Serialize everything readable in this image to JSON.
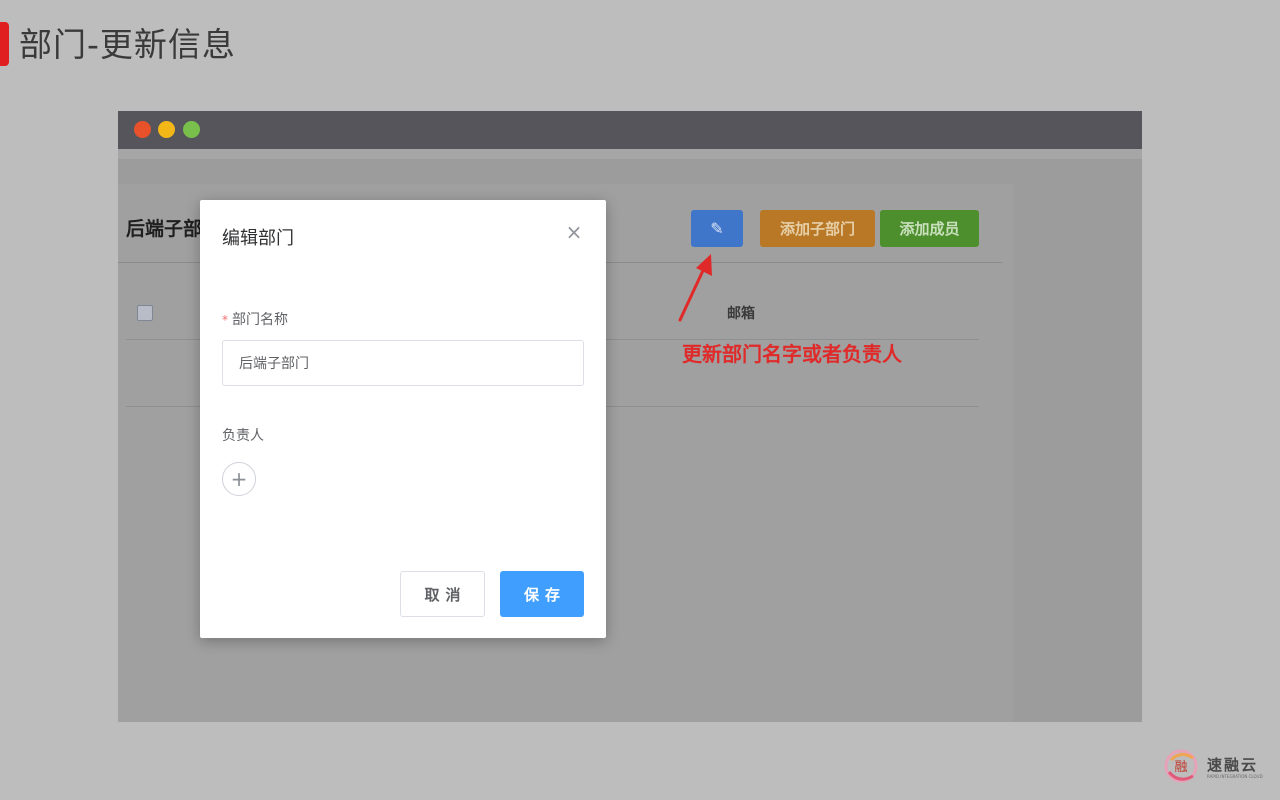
{
  "slide": {
    "title": "部门-更新信息",
    "accent_color": "#e02020"
  },
  "window": {
    "traffic_lights": [
      "#e8512a",
      "#f3b718",
      "#78c04b"
    ]
  },
  "page": {
    "dept_title": "后端子部",
    "edit_icon": "✎",
    "add_sub_dept_label": "添加子部门",
    "add_member_label": "添加成员",
    "table_header_email": "邮箱"
  },
  "annotation": {
    "text": "更新部门名字或者负责人",
    "color": "#e02a2a"
  },
  "modal": {
    "title": "编辑部门",
    "close_glyph": "×",
    "name_label": "部门名称",
    "required_mark": "*",
    "name_value": "后端子部门",
    "owner_label": "负责人",
    "add_owner_glyph": "+",
    "cancel_label": "取消",
    "save_label": "保存",
    "primary_color": "#409eff"
  },
  "logo": {
    "icon_glyph": "融",
    "name": "速融云",
    "subtitle": "RAPID INTEGRATION CLOUD"
  }
}
